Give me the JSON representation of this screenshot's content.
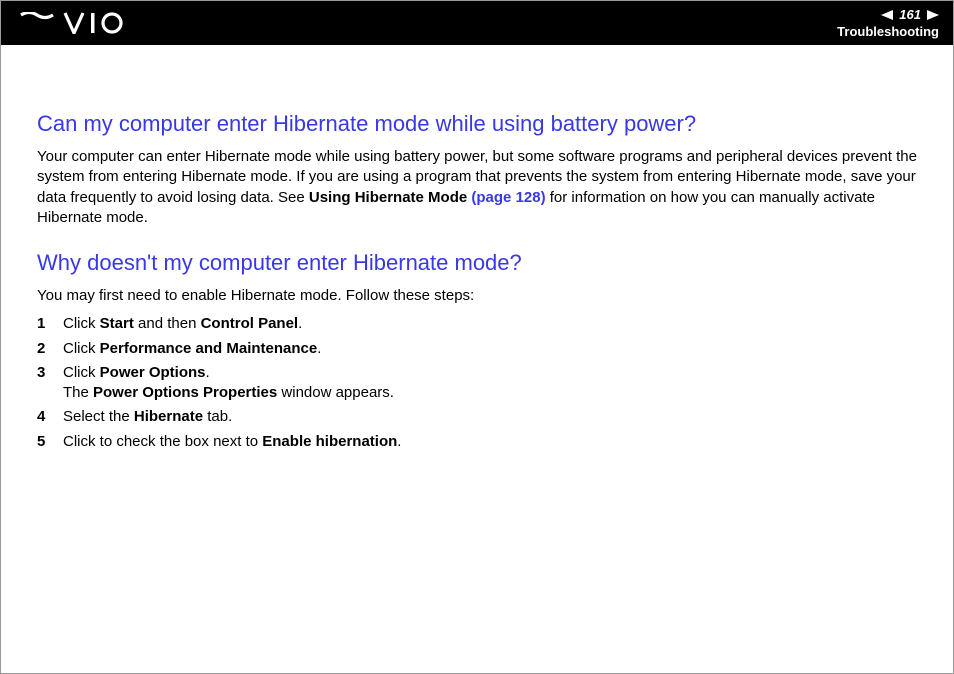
{
  "header": {
    "page_number": "161",
    "section": "Troubleshooting"
  },
  "section1": {
    "heading": "Can my computer enter Hibernate mode while using battery power?",
    "para_pre": "Your computer can enter Hibernate mode while using battery power, but some software programs and peripheral devices prevent the system from entering Hibernate mode. If you are using a program that prevents the system from entering Hibernate mode, save your data frequently to avoid losing data. See ",
    "ref_bold": "Using Hibernate Mode ",
    "ref_link": "(page 128)",
    "para_post": " for information on how you can manually activate Hibernate mode."
  },
  "section2": {
    "heading": "Why doesn't my computer enter Hibernate mode?",
    "intro": "You may first need to enable Hibernate mode. Follow these steps:",
    "steps": [
      {
        "n": "1",
        "pre": "Click ",
        "b1": "Start",
        "mid": " and then ",
        "b2": "Control Panel",
        "post": "."
      },
      {
        "n": "2",
        "pre": "Click ",
        "b1": "Performance and Maintenance",
        "post": "."
      },
      {
        "n": "3",
        "pre": "Click ",
        "b1": "Power Options",
        "post": ".",
        "line2_pre": "The ",
        "line2_b": "Power Options Properties",
        "line2_post": " window appears."
      },
      {
        "n": "4",
        "pre": "Select the ",
        "b1": "Hibernate",
        "post": " tab."
      },
      {
        "n": "5",
        "pre": "Click to check the box next to ",
        "b1": "Enable hibernation",
        "post": "."
      }
    ]
  }
}
